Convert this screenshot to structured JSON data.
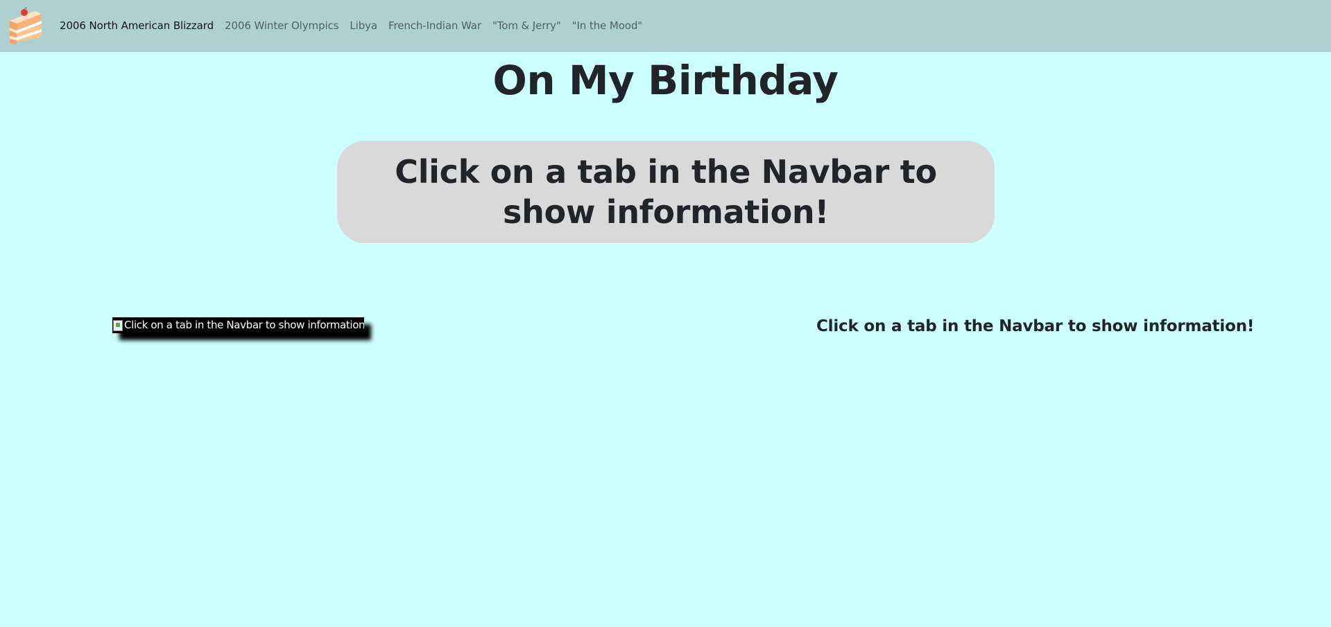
{
  "navbar": {
    "brand_icon": "cake-slice-icon",
    "links": [
      {
        "label": "2006 North American Blizzard",
        "active": true
      },
      {
        "label": "2006 Winter Olympics",
        "active": false
      },
      {
        "label": "Libya",
        "active": false
      },
      {
        "label": "French-Indian War",
        "active": false
      },
      {
        "label": "\"Tom & Jerry\"",
        "active": false
      },
      {
        "label": "\"In the Mood\"",
        "active": false
      }
    ]
  },
  "main": {
    "title": "On My Birthday",
    "info_box_text": "Click on a tab in the Navbar to show information!",
    "image_alt": "Click on a tab in the Navbar to show information!",
    "side_text": "Click on a tab in the Navbar to show information!"
  },
  "colors": {
    "background": "#ccffff",
    "navbar": "#afd0d0",
    "info_box": "#d9d9d9",
    "text": "#212529"
  }
}
